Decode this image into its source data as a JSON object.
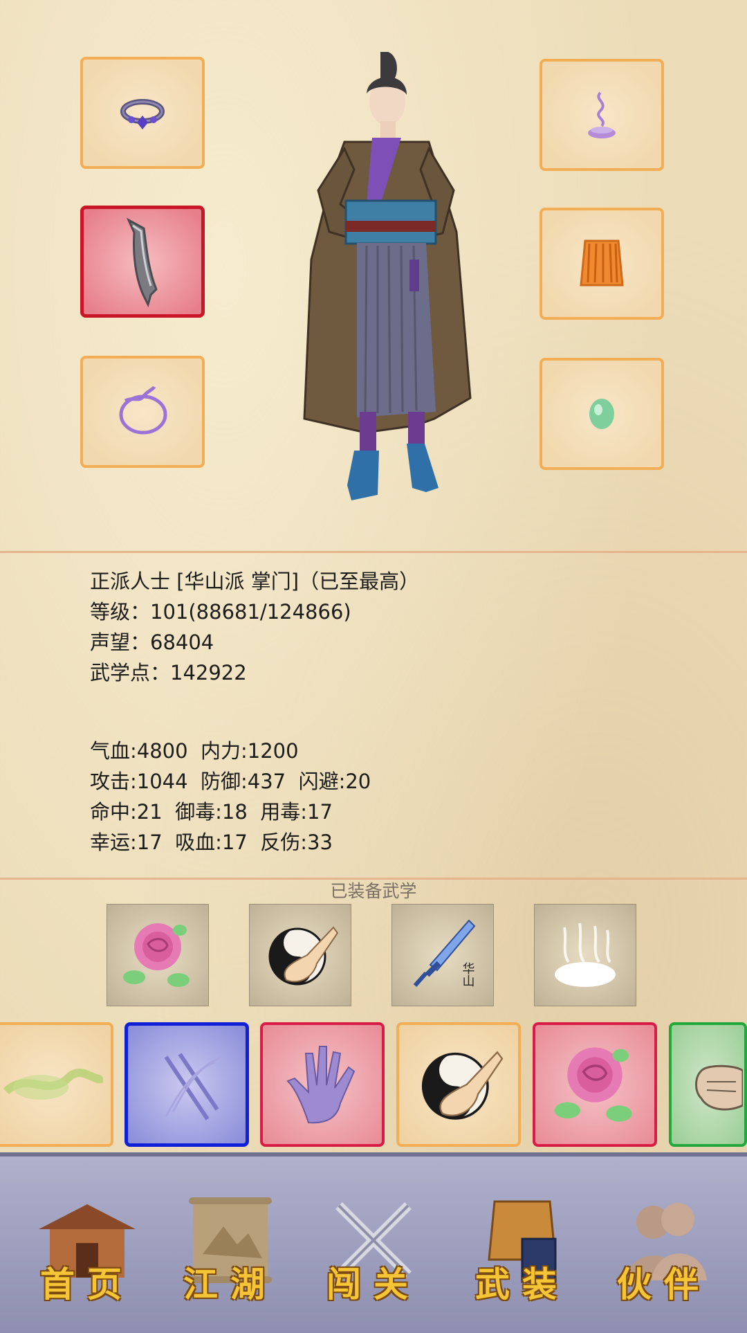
{
  "character": {
    "rank_line": "正派人士 [华山派 掌门]（已至最高）",
    "level_line": "等级：101(88681/124866)",
    "reputation_line": "声望：68404",
    "martial_points_line": "武学点：142922"
  },
  "stats": {
    "row1": "气血:4800  内力:1200",
    "row2": "攻击:1044  防御:437  闪避:20",
    "row3": "命中:21  御毒:18  用毒:17",
    "row4": "幸运:17  吸血:17  反伤:33"
  },
  "equipped_caption": "已装备武学",
  "skill_card_text": "华山",
  "nav": {
    "home": "首页",
    "jianghu": "江湖",
    "chuangguan": "闯关",
    "wuzhuang": "武装",
    "huoban": "伙伴"
  },
  "colors": {
    "slot_border": "#f2ad55",
    "selected_border": "#c81628",
    "blue_border": "#1020d8",
    "red_border": "#d81c46",
    "green_border": "#22a83a",
    "nav_bg": "#9b9cbb",
    "nav_label": "#f6c535"
  },
  "icons": {
    "slot_left_1": "ring-icon",
    "slot_left_2": "sword-icon",
    "slot_left_3": "bracelet-icon",
    "slot_right_1": "incense-icon",
    "slot_right_2": "armor-icon",
    "slot_right_3": "jade-icon",
    "skill_1": "rose-icon",
    "skill_2": "taichi-palm-icon",
    "skill_3": "huashan-sword-icon",
    "skill_4": "cloud-steps-icon",
    "bank_1": "vine-icon",
    "bank_2": "twin-swords-icon",
    "bank_3": "palm-icon",
    "bank_4": "taichi-palm-icon",
    "bank_5": "rose-icon",
    "bank_6": "fist-icon"
  }
}
